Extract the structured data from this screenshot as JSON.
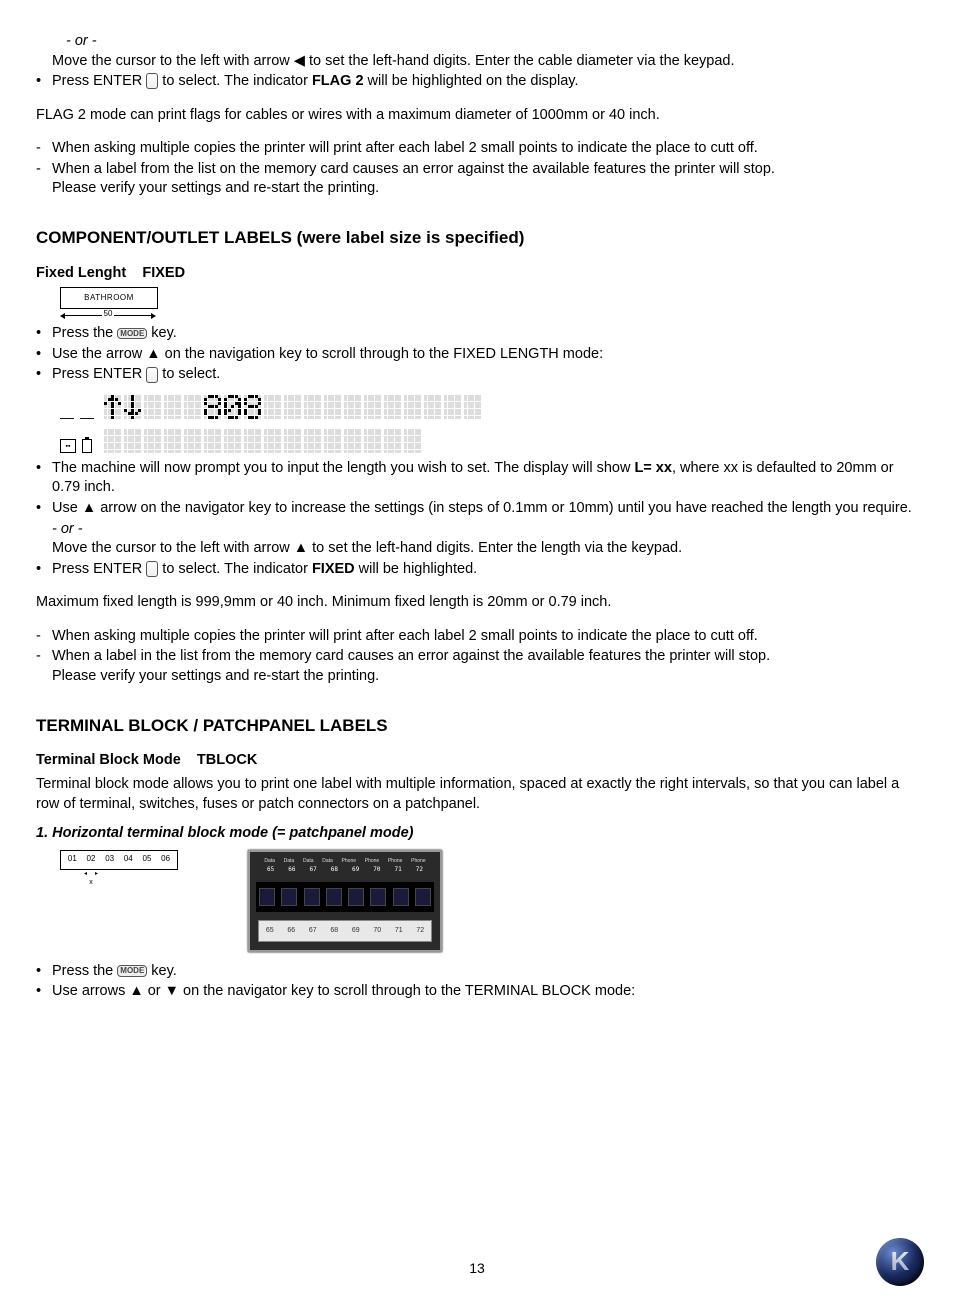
{
  "top": {
    "or": "- or -",
    "move_line": "Move the cursor to the left with arrow ◀ to set the left-hand digits. Enter the cable diameter via the keypad.",
    "press_enter_a": "Press ENTER ",
    "press_enter_b": " to select. The indicator ",
    "flag2": "FLAG 2",
    "press_enter_c": " will be highlighted on the display.",
    "flag2_cap": "FLAG 2 mode can print flags for cables or wires with a maximum diameter of 1000mm or 40 inch.",
    "dash1": "When asking multiple copies the printer will print after each label 2 small points to indicate the place to cutt off.",
    "dash2a": "When a label from the list on the memory card causes an error against the available features the printer will stop.",
    "dash2b": "Please verify your settings and re-start the printing."
  },
  "comp": {
    "heading": "COMPONENT/OUTLET LABELS (were label size is specified)",
    "sub_a": "Fixed Lenght",
    "sub_b": "FIXED",
    "box_text": "BATHROOM",
    "box_size": "50",
    "b1a": "Press the ",
    "b1_icon": "MODE",
    "b1b": " key.",
    "b2": "Use the arrow ▲ on the navigation key to scroll through to the FIXED LENGTH mode:",
    "b3a": "Press ENTER ",
    "b3b": " to select.",
    "b4a": "The machine will now prompt you to input the length you wish to set. The display will show ",
    "b4_bold": "L= xx",
    "b4b": ", where xx is defaulted to 20mm or 0.79 inch.",
    "b5": "Use ▲ arrow on the navigator key to increase the settings (in steps of 0.1mm or 10mm) until you have reached the length you require.",
    "or": "- or -",
    "b6": "Move the cursor to the left with arrow ▲ to set the left-hand digits. Enter the length via the keypad.",
    "b7a": "Press ENTER ",
    "b7b": " to select. The indicator ",
    "b7_bold": "FIXED",
    "b7c": " will be highlighted.",
    "max": "Maximum fixed length is 999,9mm or 40 inch. Minimum fixed length is 20mm or 0.79 inch.",
    "dash1": "When asking multiple copies the printer will print after each label 2 small points to indicate the place to cutt off.",
    "dash2a": "When a label in the list from the memory card causes an error against the available features the printer will stop.",
    "dash2b": "Please verify your settings and re-start the printing."
  },
  "term": {
    "heading": "TERMINAL BLOCK / PATCHPANEL LABELS",
    "sub_a": "Terminal Block Mode",
    "sub_b": "TBLOCK",
    "desc": "Terminal block mode allows you to print one label with multiple information, spaced at exactly the right intervals, so that you can label a row of terminal, switches, fuses or patch connectors on a patchpanel.",
    "mode1": "1. Horizontal terminal block mode (= patchpanel mode)",
    "tblock_vals": [
      "01",
      "02",
      "03",
      "04",
      "05",
      "06"
    ],
    "photo_top_labels": [
      "Data",
      "Data",
      "Data",
      "Data",
      "Phone",
      "Phone",
      "Phone",
      "Phone"
    ],
    "photo_nums": [
      "65",
      "66",
      "67",
      "68",
      "69",
      "70",
      "71",
      "72"
    ],
    "b1a": "Press the ",
    "b1_icon": "MODE",
    "b1b": " key.",
    "b2": "Use arrows ▲ or ▼ on the navigator key to scroll through to the TERMINAL BLOCK mode:"
  },
  "page_number": "13",
  "chart_data": {
    "type": "table",
    "lcd_display_rows": [
      "↑↓   808",
      ""
    ]
  }
}
